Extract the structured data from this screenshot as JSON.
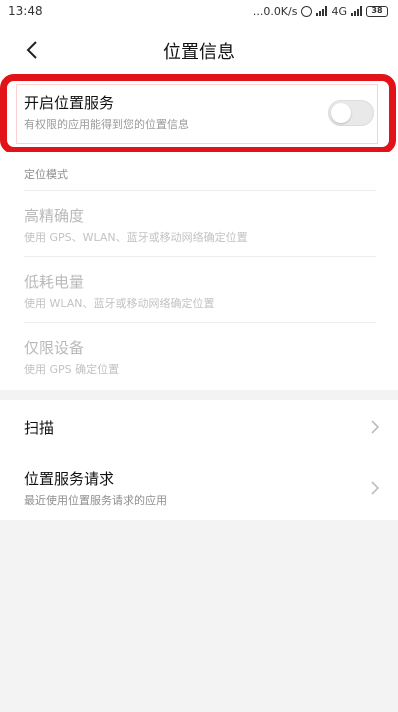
{
  "status_bar": {
    "time": "13:48",
    "net_speed": "...0.0K/s",
    "network_type": "4G",
    "battery": "38",
    "icons": [
      "alarm-icon",
      "signal-icon",
      "battery-icon"
    ]
  },
  "header": {
    "title": "位置信息",
    "back_icon": "chevron-left-icon"
  },
  "location_toggle": {
    "title": "开启位置服务",
    "subtitle": "有权限的应用能得到您的位置信息",
    "enabled": false
  },
  "modes": {
    "section_label": "定位模式",
    "items": [
      {
        "title": "高精确度",
        "subtitle": "使用 GPS、WLAN、蓝牙或移动网络确定位置"
      },
      {
        "title": "低耗电量",
        "subtitle": "使用 WLAN、蓝牙或移动网络确定位置"
      },
      {
        "title": "仅限设备",
        "subtitle": "使用 GPS 确定位置"
      }
    ]
  },
  "nav_items": [
    {
      "title": "扫描",
      "subtitle": ""
    },
    {
      "title": "位置服务请求",
      "subtitle": "最近使用位置服务请求的应用"
    }
  ],
  "colors": {
    "highlight": "#e11218",
    "background": "#f3f3f3",
    "disabled_text": "#b9b9b9"
  }
}
